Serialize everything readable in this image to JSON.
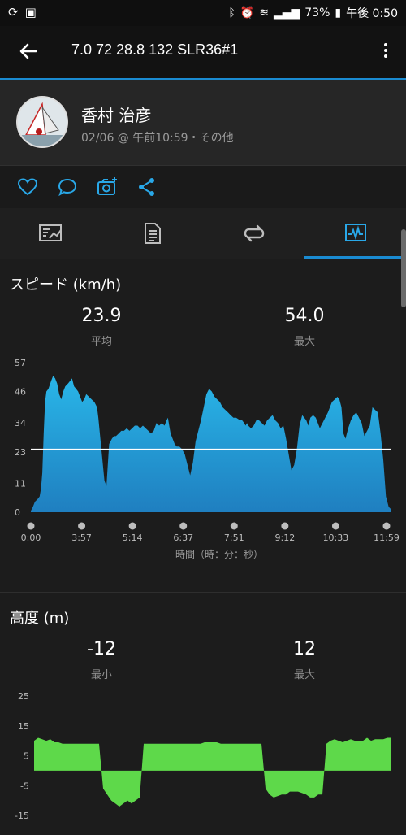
{
  "status": {
    "battery": "73%",
    "time": "午後 0:50"
  },
  "appbar": {
    "title": "7.0  72  28.8  132  SLR36#1"
  },
  "profile": {
    "name": "香村 治彦",
    "meta": "02/06 @ 午前10:59・その他"
  },
  "speed": {
    "title": "スピード (km/h)",
    "avg_value": "23.9",
    "avg_label": "平均",
    "max_value": "54.0",
    "max_label": "最大",
    "xlabel": "時間（時：分：秒）"
  },
  "altitude": {
    "title": "高度 (m)",
    "min_value": "-12",
    "min_label": "最小",
    "max_value": "12",
    "max_label": "最大"
  },
  "colors": {
    "accent": "#1a8bd1",
    "speed_fill_top": "#29b6e8",
    "speed_fill_bottom": "#1f7fc0",
    "altitude_fill": "#5ed94a"
  },
  "chart_data": [
    {
      "type": "area",
      "title": "スピード (km/h)",
      "xlabel": "時間（時：分：秒）",
      "ylabel": "",
      "y_ticks": [
        "0",
        "11",
        "23",
        "34",
        "46",
        "57"
      ],
      "ylim": [
        0,
        57
      ],
      "x_ticks": [
        "0:00",
        "3:57",
        "5:14",
        "6:37",
        "7:51",
        "9:12",
        "10:33",
        "11:59"
      ],
      "average_line": 23.9,
      "x": [
        0,
        3,
        6,
        10,
        13,
        15,
        17,
        19,
        21,
        23,
        26,
        30,
        33,
        36,
        39,
        42,
        45,
        48,
        51,
        55,
        58,
        61,
        64,
        67,
        70,
        73,
        76,
        79,
        82,
        86,
        90,
        94,
        98,
        100,
        103,
        106,
        109,
        112,
        116,
        120,
        123,
        126,
        130,
        134,
        138,
        142,
        146,
        150,
        154,
        158,
        162,
        166,
        170,
        174,
        178,
        182,
        186,
        190,
        194,
        198,
        201,
        203,
        205,
        207,
        210,
        213,
        216,
        220,
        224,
        228,
        232,
        236,
        240,
        244,
        248,
        252,
        256,
        260,
        264,
        268,
        272,
        276,
        280,
        284,
        288,
        292,
        296,
        300,
        304,
        310,
        313,
        316,
        318,
        320,
        322,
        326,
        330,
        334,
        338,
        342,
        346,
        350,
        354,
        358,
        362,
        366,
        370,
        374,
        378,
        382,
        386,
        390,
        394,
        398,
        402,
        405,
        408,
        411,
        414,
        418,
        422,
        425,
        428,
        430,
        432,
        436,
        440,
        443,
        446,
        450,
        454,
        457,
        460,
        463,
        466,
        470,
        474,
        478,
        482,
        486,
        490,
        494,
        498,
        502,
        506,
        510,
        514,
        518,
        522,
        526,
        530,
        534
      ],
      "values": [
        0.5,
        2,
        4,
        5,
        6,
        9,
        15,
        30,
        42,
        46,
        47,
        50,
        52,
        51,
        49,
        45,
        43,
        46,
        48,
        49,
        50,
        51,
        48,
        47,
        46,
        44,
        42,
        43,
        45,
        44,
        43,
        42,
        40,
        36,
        28,
        20,
        12,
        10,
        26,
        28,
        29,
        29,
        30,
        31,
        31,
        32,
        31,
        32,
        33,
        33,
        32,
        33,
        32,
        31,
        30,
        31,
        34,
        33,
        34,
        33,
        35,
        36,
        33,
        30,
        28,
        26,
        25,
        25,
        24,
        22,
        18,
        14,
        19,
        27,
        31,
        35,
        40,
        45,
        47,
        46,
        44,
        43,
        42,
        40,
        39,
        38,
        37,
        36,
        36,
        35,
        35,
        34,
        33,
        34,
        33,
        32,
        33,
        35,
        35,
        34,
        33,
        35,
        36,
        37,
        35,
        34,
        32,
        33,
        28,
        22,
        16,
        18,
        24,
        33,
        37,
        36,
        35,
        33,
        36,
        37,
        36,
        34,
        32,
        33,
        34,
        36,
        38,
        40,
        42,
        43,
        44,
        43,
        40,
        30,
        28,
        32,
        35,
        37,
        38,
        36,
        34,
        29,
        31,
        33,
        40,
        39,
        38,
        30,
        20,
        6,
        2,
        1
      ],
      "x_range": [
        0,
        534
      ]
    },
    {
      "type": "area",
      "title": "高度 (m)",
      "y_ticks": [
        "25",
        "15",
        "5",
        "-5",
        "-15"
      ],
      "ylim": [
        -15,
        25
      ],
      "x": [
        0,
        5,
        10,
        15,
        20,
        25,
        30,
        35,
        40,
        45,
        50,
        55,
        60,
        65,
        70,
        75,
        80,
        85,
        90,
        95,
        100,
        105,
        110,
        115,
        120,
        125,
        130,
        135,
        140,
        145,
        150,
        155,
        160,
        165,
        170,
        175,
        180,
        185,
        190,
        195,
        200,
        205,
        210,
        215,
        220,
        225,
        230,
        235,
        240,
        245,
        250,
        255,
        260,
        265,
        270,
        275,
        280,
        285,
        290,
        295,
        300,
        305,
        310,
        315,
        320,
        325,
        330,
        335,
        340,
        345,
        350,
        355,
        360,
        365,
        370,
        375,
        380,
        385,
        390,
        395,
        400,
        405,
        410,
        415,
        420,
        425,
        430,
        435,
        440
      ],
      "values": [
        10,
        11,
        10.5,
        10,
        10.5,
        9.5,
        9.5,
        9,
        9,
        9,
        9,
        9,
        9,
        9,
        9,
        9,
        9,
        -6,
        -8,
        -10,
        -11,
        -12,
        -11,
        -10,
        -11,
        -10,
        -9,
        9,
        9,
        9,
        9,
        9,
        9,
        9,
        9,
        9,
        9,
        9,
        9,
        9,
        9,
        9,
        9.5,
        9.5,
        9.5,
        9.5,
        9,
        9,
        9,
        9,
        9,
        9,
        9,
        9,
        9,
        9,
        9,
        -6,
        -8,
        -9,
        -8.5,
        -8,
        -8,
        -7,
        -7,
        -7,
        -7.5,
        -8,
        -9,
        -9,
        -8,
        -8,
        9,
        10,
        10.5,
        10,
        9.5,
        10,
        10.5,
        10,
        10,
        10,
        11,
        10,
        10.5,
        10.5,
        10.5,
        11,
        11
      ],
      "x_range": [
        0,
        440
      ]
    }
  ]
}
